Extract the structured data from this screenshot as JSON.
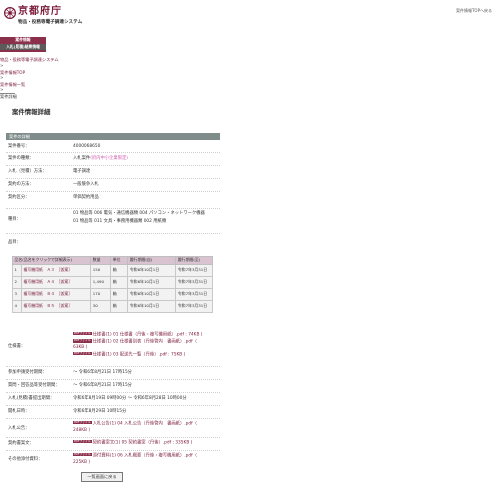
{
  "header": {
    "org_name": "京都府庁",
    "system_name": "物品・役務等電子調達システム",
    "top_link": "案件情報TOPへ戻る"
  },
  "menu": {
    "item1": "案件情報",
    "item2": "入札(見積)結果情報"
  },
  "breadcrumb": {
    "home": "物品・役務等電子調達システム",
    "sep1": ">",
    "top": "案件情報TOP",
    "sep2": ">",
    "list": "案件情報一覧",
    "sep3": ">",
    "current": "案件詳細"
  },
  "page_title": "案件情報詳細",
  "panel_title": "案件の詳細",
  "fields": {
    "case_no_label": "案件番号：",
    "case_no": "4000068650",
    "type_label": "案件の種類：",
    "type": "入札案件",
    "type_tag": "(府内中小企業限定)",
    "method_label": "入札（見積）方法：",
    "method": "電子調達",
    "contract_method_label": "契約の方法：",
    "contract_method": "一般競争入札",
    "contract_cat_label": "契約区分：",
    "contract_cat": "単価契約用品",
    "kind_label": "種目：",
    "kind_line1": "01 物品等 006 電気・通信機器類 004 パソコン・ネットワーク機器",
    "kind_line2": "01 物品等 011 文具・事務用機器類 002 用紙類",
    "goods_label": "品目：",
    "spec_label": "仕様書：",
    "spec_files": [
      "仕様書(1) 01 仕様書（丹後・複写機用紙）.pdf : 74KB )",
      "仕様書(1) 02 仕様書別表（丹後管内　書画紙）.pdf（",
      "63KB )",
      "仕様書(1) 03 配送先一覧（丹後）.pdf : 75KB )"
    ],
    "entry_period_label": "参加申請受付期間：",
    "entry_period": "〜 令和6年8月21日 17時15分",
    "question_period_label": "質問・回答品等受付期間：",
    "question_period": "〜 令和6年8月21日 17時15分",
    "bid_period_label": "入札(見積)書提出期間：",
    "bid_period": "令和6年8月19日 09時00分 〜 令和6年8月28日 10時00分",
    "opening_label": "開札日時：",
    "opening": "令和6年8月29日 10時15分",
    "notice_label": "入札公告：",
    "notice_file1": "入札公告(1) 04 入札公告（丹後管内　書画紙）.pdf（",
    "notice_file2": "248KB )",
    "contract_form_label": "契約書案文：",
    "contract_form_file1": "契約書案文(1) 05 契約書案（丹後）.pdf : 335KB )",
    "other_label": "その他添付資料：",
    "other_file1": "添付資料(1) 06 入札概要（丹後・複写機用紙）.pdf（",
    "other_file2": "225KB )",
    "pdf_badge": "PDFファイル"
  },
  "goods_table": {
    "headers": [
      "品名(品名をクリックで詳細表示)",
      "数量",
      "単位",
      "履行期間(自)",
      "履行期間(至)"
    ],
    "rows": [
      {
        "no": "1",
        "name": "複写機用紙　Ａ３　［仮案］",
        "qty": "150",
        "unit": "箱",
        "from": "令和6年10月1日",
        "to": "令和7年3月31日"
      },
      {
        "no": "2",
        "name": "複写機用紙　Ａ４　［仮案］",
        "qty": "1,490",
        "unit": "箱",
        "from": "令和6年10月1日",
        "to": "令和7年3月31日"
      },
      {
        "no": "3",
        "name": "複写機用紙　Ｂ４　［仮案］",
        "qty": "170",
        "unit": "箱",
        "from": "令和6年10月1日",
        "to": "令和7年3月31日"
      },
      {
        "no": "4",
        "name": "複写機用紙　Ｂ５　［仮案］",
        "qty": "30",
        "unit": "箱",
        "from": "令和6年10月1日",
        "to": "令和7年3月31日"
      }
    ]
  },
  "back_button": "一覧画面に戻る",
  "colors": {
    "brand": "#8c2f4b",
    "panel_head": "#7f8c8a",
    "table_head": "#d9c3d1"
  }
}
